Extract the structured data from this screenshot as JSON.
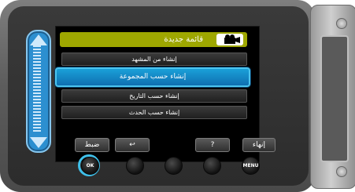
{
  "menu": {
    "title": "قائمة جديدة",
    "items": [
      {
        "label": "إنشاء من المشهد",
        "selected": false
      },
      {
        "label": "إنشاء حسب المجموعة",
        "selected": true
      },
      {
        "label": "إنشاء حسب التاريخ",
        "selected": false
      },
      {
        "label": "إنشاء حسب الحدث",
        "selected": false
      }
    ]
  },
  "soft_buttons": {
    "set": "ضبط",
    "back": "↩",
    "help": "?",
    "end": "إنهاء"
  },
  "hardware_buttons": {
    "ok": "OK",
    "menu": "MENU"
  },
  "colors": {
    "accent": "#1aa0d8",
    "highlight_ring": "#3fc0ea",
    "header": "#9ea700"
  }
}
